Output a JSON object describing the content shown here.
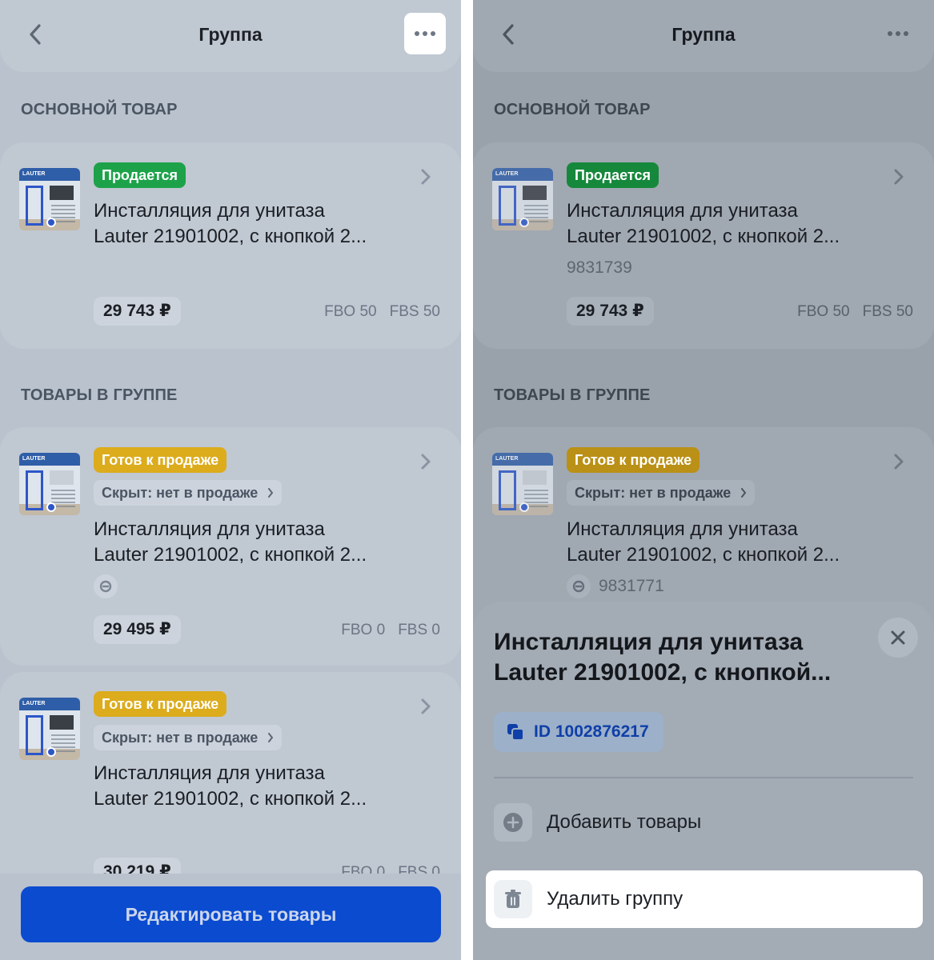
{
  "screens": {
    "left": {
      "header": {
        "title": "Группа"
      },
      "main_section_title": "ОСНОВНОЙ ТОВАР",
      "main_product": {
        "status": "Продается",
        "name_line1": "Инсталляция для унитаза",
        "name_line2": "Lauter 21901002, с кнопкой 2...",
        "price": "29 743 ₽",
        "fbo": "FBO 50",
        "fbs": "FBS 50"
      },
      "group_section_title": "ТОВАРЫ В ГРУППЕ",
      "group_products": [
        {
          "status": "Готов к продаже",
          "hidden_label": "Скрыт: нет в продаже",
          "name_line1": "Инсталляция для унитаза",
          "name_line2": "Lauter 21901002, с кнопкой 2...",
          "price": "29 495 ₽",
          "fbo": "FBO 0",
          "fbs": "FBS 0"
        },
        {
          "status": "Готов к продаже",
          "hidden_label": "Скрыт: нет в продаже",
          "name_line1": "Инсталляция для унитаза",
          "name_line2": "Lauter 21901002, с кнопкой 2...",
          "price": "30 219 ₽",
          "fbo": "FBO 0",
          "fbs": "FBS 0"
        }
      ],
      "edit_button": "Редактировать товары"
    },
    "right": {
      "header": {
        "title": "Группа"
      },
      "main_section_title": "ОСНОВНОЙ ТОВАР",
      "main_product": {
        "status": "Продается",
        "name_line1": "Инсталляция для унитаза",
        "name_line2": "Lauter 21901002, с кнопкой 2...",
        "sku": "9831739",
        "price": "29 743 ₽",
        "fbo": "FBO 50",
        "fbs": "FBS 50"
      },
      "group_section_title": "ТОВАРЫ В ГРУППЕ",
      "group_product": {
        "status": "Готов к продаже",
        "hidden_label": "Скрыт: нет в продаже",
        "name_line1": "Инсталляция для унитаза",
        "name_line2": "Lauter 21901002, с кнопкой 2...",
        "sku": "9831771"
      },
      "sheet": {
        "title": "Инсталляция для унитаза Lauter 21901002, с кнопкой...",
        "id_chip": "ID 1002876217",
        "menu": {
          "add": "Добавить товары",
          "delete": "Удалить группу"
        }
      }
    }
  },
  "thumb_logo": "LAUTER",
  "colors": {
    "primary_blue": "#0b4bd0",
    "status_green": "#1da24a",
    "status_yellow": "#dcac1c"
  },
  "icons": [
    "back-icon",
    "more-icon",
    "chevron-right-icon",
    "link-icon",
    "close-icon",
    "copy-icon",
    "plus-circle-icon",
    "trash-icon"
  ]
}
